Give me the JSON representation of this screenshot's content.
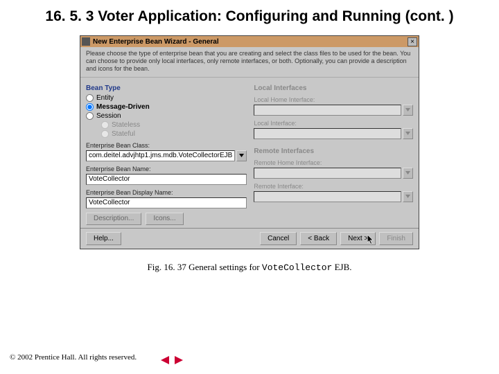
{
  "slide_title": "16. 5. 3   Voter Application: Configuring and Running (cont. )",
  "dialog": {
    "title": "New Enterprise Bean Wizard - General",
    "intro": "Please choose the type of enterprise bean that you are creating and select the class files to be used for the bean. You can choose to provide only local interfaces, only remote interfaces, or both. Optionally, you can provide a description and icons for the bean.",
    "bean_type_label": "Bean Type",
    "radios": {
      "entity": "Entity",
      "message": "Message-Driven",
      "session": "Session",
      "stateless": "Stateless",
      "stateful": "Stateful"
    },
    "left": {
      "class_label": "Enterprise Bean Class:",
      "class_value": "com.deitel.advjhtp1.jms.mdb.VoteCollectorEJB",
      "name_label": "Enterprise Bean Name:",
      "name_value": "VoteCollector",
      "display_label": "Enterprise Bean Display Name:",
      "display_value": "VoteCollector",
      "description_btn": "Description...",
      "icons_btn": "Icons..."
    },
    "right": {
      "local_hdr": "Local Interfaces",
      "local_home": "Local Home Interface:",
      "local_if": "Local Interface:",
      "remote_hdr": "Remote Interfaces",
      "remote_home": "Remote Home Interface:",
      "remote_if": "Remote Interface:"
    },
    "buttons": {
      "help": "Help...",
      "cancel": "Cancel",
      "back": "< Back",
      "next": "Next >",
      "finish": "Finish"
    }
  },
  "caption_prefix": "Fig. 16. 37  General settings for ",
  "caption_mono": "VoteCollector",
  "caption_suffix": " EJB.",
  "copyright": "© 2002 Prentice Hall. All rights reserved."
}
